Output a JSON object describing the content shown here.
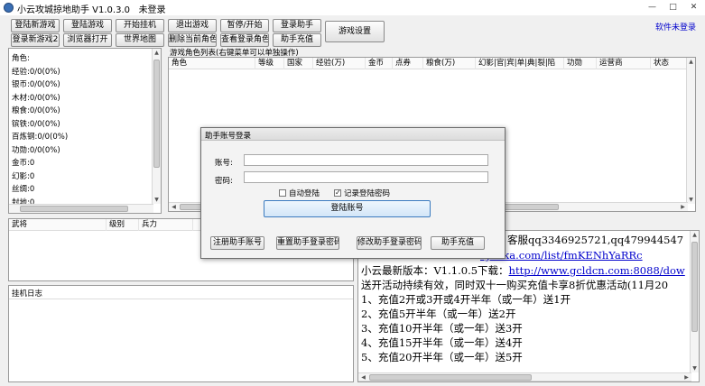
{
  "title": "小云攻城掠地助手 V1.0.3.0",
  "login_status": "未登录",
  "software_login_status": "软件未登录",
  "toolbar_row1": [
    "登陆新游戏",
    "登陆游戏",
    "开始挂机",
    "退出游戏",
    "暂停/开始",
    "登录助手"
  ],
  "toolbar_row2": [
    "登录新游戏2",
    "浏览器打开",
    "世界地图",
    "删除当前角色",
    "查看登录角色",
    "助手充值"
  ],
  "game_settings": "游戏设置",
  "stats": [
    "角色:",
    "经验:0/0(0%)",
    "银币:0/0(0%)",
    "木材:0/0(0%)",
    "粮食:0/0(0%)",
    "镔铁:0/0(0%)",
    "百炼钢:0/0(0%)",
    "功勋:0/0(0%)",
    "金币:0",
    "幻影:0",
    "丝绸:0",
    "封地:0"
  ],
  "role_list_title": "游戏角色列表(右键菜单可以单独操作)",
  "role_columns": [
    "角色",
    "等级",
    "国家",
    "经验(万)",
    "金币",
    "点券",
    "粮食(万)",
    "幻影|官|宾|单|典|裂|陷",
    "功勋",
    "运营商",
    "状态"
  ],
  "general_columns": [
    "武将",
    "级别",
    "兵力"
  ],
  "log_title": "挂机日志",
  "announcement": {
    "lines": [
      "客服qq3346925721,qq479944547",
      "ojunka.com/list/fmKENhYaRRc",
      "小云最新版本：V1.1.0.5下载：",
      "送开活动持续有效，同时双十一购买充值卡享8折优惠活动(11月20",
      "1、充值2开或3开或4开半年（或一年）送1开",
      "2、充值5开半年（或一年）送2开",
      "3、充值10开半年（或一年）送3开",
      "4、充值15开半年（或一年）送4开",
      "5、充值20开半年（或一年）送5开"
    ],
    "download_link": "http://www.gcldcn.com:8088/dow"
  },
  "dialog": {
    "title": "助手账号登录",
    "account_label": "账号:",
    "password_label": "密码:",
    "auto_login": "自动登陆",
    "remember_password": "记录登陆密码",
    "auto_login_checked": false,
    "remember_checked": true,
    "login_button": "登陆账号",
    "buttons": [
      "注册助手账号",
      "重置助手登录密码",
      "修改助手登录密码",
      "助手充值"
    ]
  }
}
